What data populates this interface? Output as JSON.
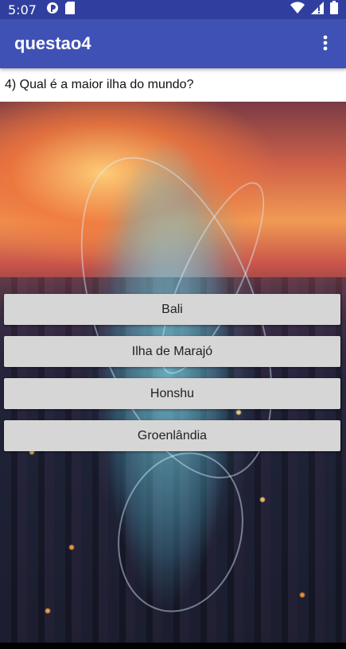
{
  "status_bar": {
    "time": "5:07",
    "icons": [
      "app-notification-icon",
      "sd-card-icon",
      "wifi-icon",
      "signal-icon",
      "battery-icon"
    ],
    "color": "#303F9F"
  },
  "app_bar": {
    "title": "questao4",
    "menu_icon": "overflow-menu-icon",
    "color": "#3F51B5"
  },
  "question": {
    "text": "4) Qual é a maior ilha do mundo?"
  },
  "answers": [
    {
      "label": "Bali"
    },
    {
      "label": "Ilha de Marajó"
    },
    {
      "label": "Honshu"
    },
    {
      "label": "Groenlândia"
    }
  ],
  "background": {
    "description_icon": "city-hologram-background-image"
  }
}
